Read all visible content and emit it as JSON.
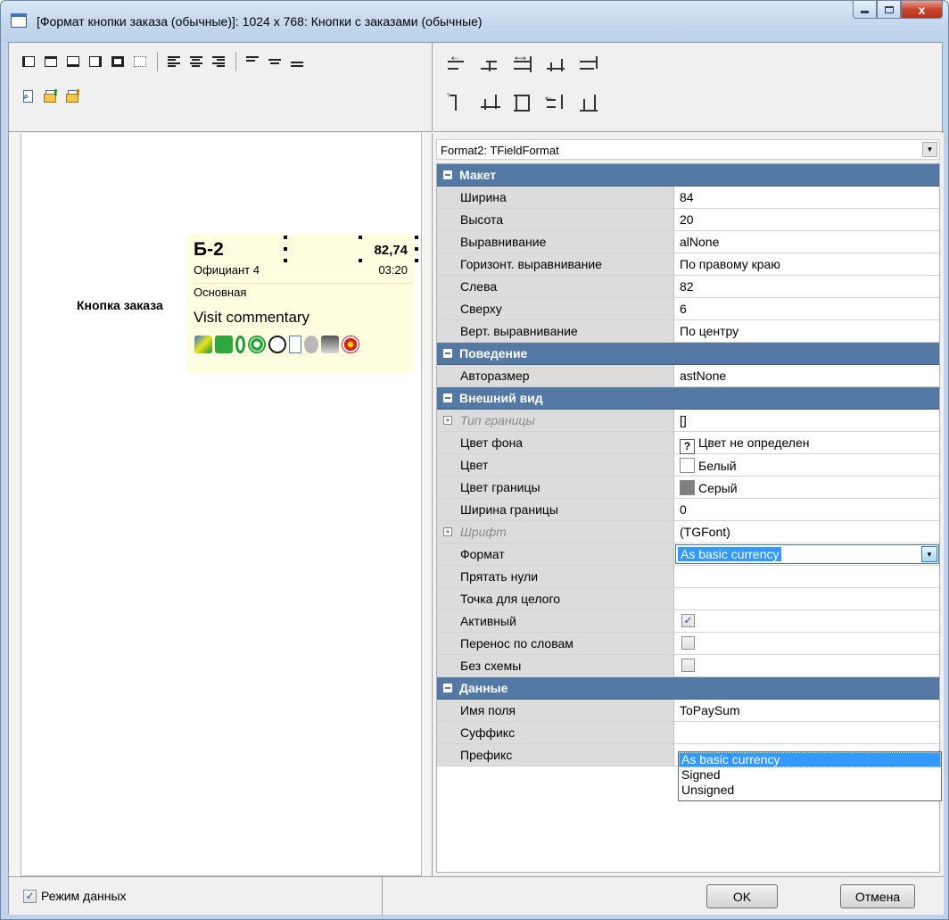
{
  "window": {
    "title": "[Формат кнопки заказа (обычные)]: 1024 x 768: Кнопки с заказами (обычные)",
    "controls": {
      "minimize": "minimize",
      "maximize": "maximize",
      "close": "x"
    }
  },
  "toolbar_left": {
    "row1": [
      "border-left-icon",
      "border-top-icon",
      "border-bottom-icon",
      "border-right-icon",
      "border-all-icon",
      "border-none-icon",
      "align-left-icon",
      "align-center-icon",
      "align-right-icon",
      "valign-top-icon",
      "valign-center-icon",
      "valign-bottom-icon"
    ],
    "row2": [
      "preview-icon",
      "import-icon",
      "export-icon"
    ]
  },
  "toolbar_right": {
    "row1": [
      "align-lefts-icon",
      "align-hcenters-icon",
      "align-rights-icon",
      "space-horizontal-icon",
      "same-width-icon"
    ],
    "row2": [
      "align-tops-icon",
      "align-vcenters-icon",
      "align-bottoms-icon",
      "space-vertical-icon",
      "same-height-icon"
    ]
  },
  "preview": {
    "label": "Кнопка заказа",
    "card": {
      "code": "Б-2",
      "sum": "82,74",
      "waiter": "Официант 4",
      "time": "03:20",
      "type": "Основная",
      "comment": "Visit commentary",
      "status_icons": [
        "pen-icon",
        "money-icon",
        "zero-icon",
        "green-circle-icon",
        "clock-icon",
        "document-icon",
        "key-icon",
        "printer-icon",
        "target-icon"
      ]
    }
  },
  "inspector": {
    "selector": "Format2: TFieldFormat",
    "sections": [
      {
        "title": "Макет",
        "rows": [
          {
            "name": "Ширина",
            "value": "84"
          },
          {
            "name": "Высота",
            "value": "20"
          },
          {
            "name": "Выравнивание",
            "value": "alNone"
          },
          {
            "name": "Горизонт. выравнивание",
            "value": "По правому краю"
          },
          {
            "name": "Слева",
            "value": "82"
          },
          {
            "name": "Сверху",
            "value": "6"
          },
          {
            "name": "Верт. выравнивание",
            "value": "По центру"
          }
        ]
      },
      {
        "title": "Поведение",
        "rows": [
          {
            "name": "Авторазмер",
            "value": "astNone"
          }
        ]
      },
      {
        "title": "Внешний вид",
        "rows": [
          {
            "name": "Тип границы",
            "value": "[]"
          },
          {
            "name": "Цвет фона",
            "value": "Цвет не определен"
          },
          {
            "name": "Цвет",
            "value": "Белый"
          },
          {
            "name": "Цвет границы",
            "value": "Серый"
          },
          {
            "name": "Ширина границы",
            "value": "0"
          },
          {
            "name": "Шрифт",
            "value": "(TGFont)"
          },
          {
            "name": "Формат",
            "value": "As basic currency"
          },
          {
            "name": "Прятать нули",
            "value": ""
          },
          {
            "name": "Точка для целого",
            "value": ""
          },
          {
            "name": "Активный",
            "checked": true
          },
          {
            "name": "Перенос по словам",
            "checked": false
          },
          {
            "name": "Без схемы",
            "checked": false
          }
        ]
      },
      {
        "title": "Данные",
        "rows": [
          {
            "name": "Имя поля",
            "value": "ToPaySum"
          },
          {
            "name": "Суффикс",
            "value": ""
          },
          {
            "name": "Префикс",
            "value": ""
          }
        ]
      }
    ],
    "format_dropdown": {
      "options": [
        "As basic currency",
        "Signed",
        "Unsigned"
      ],
      "selected": "As basic currency"
    }
  },
  "footer": {
    "data_mode_label": "Режим данных",
    "data_mode_checked": true,
    "ok": "OK",
    "cancel": "Отмена"
  },
  "colors": {
    "category_header": "#5479a4",
    "selection": "#3399ff",
    "card_background": "#fffde0",
    "swatch_white": "#ffffff",
    "swatch_gray": "#808080"
  }
}
